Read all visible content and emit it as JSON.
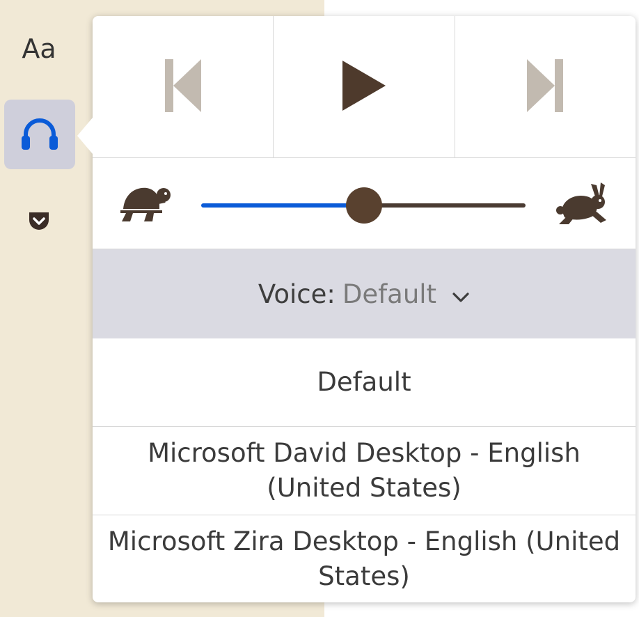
{
  "sidebar": {
    "font_label": "Aa",
    "narrate_icon": "headphones-icon",
    "pocket_icon": "pocket-icon"
  },
  "controls": {
    "prev_icon": "skip-back-icon",
    "play_icon": "play-icon",
    "next_icon": "skip-forward-icon"
  },
  "rate": {
    "slow_icon": "turtle-icon",
    "fast_icon": "rabbit-icon",
    "value": 0.5
  },
  "voice": {
    "label": "Voice:",
    "selected": "Default",
    "options": [
      "Default",
      "Microsoft David Desktop - English (United States)",
      "Microsoft Zira Desktop - English (United States)"
    ]
  },
  "colors": {
    "accent_blue": "#0a5bd8",
    "brown": "#59412f",
    "sidebar_bg": "#f1e9d6",
    "selected_bg": "#cfcfdb",
    "voice_header_bg": "#dadae2"
  }
}
